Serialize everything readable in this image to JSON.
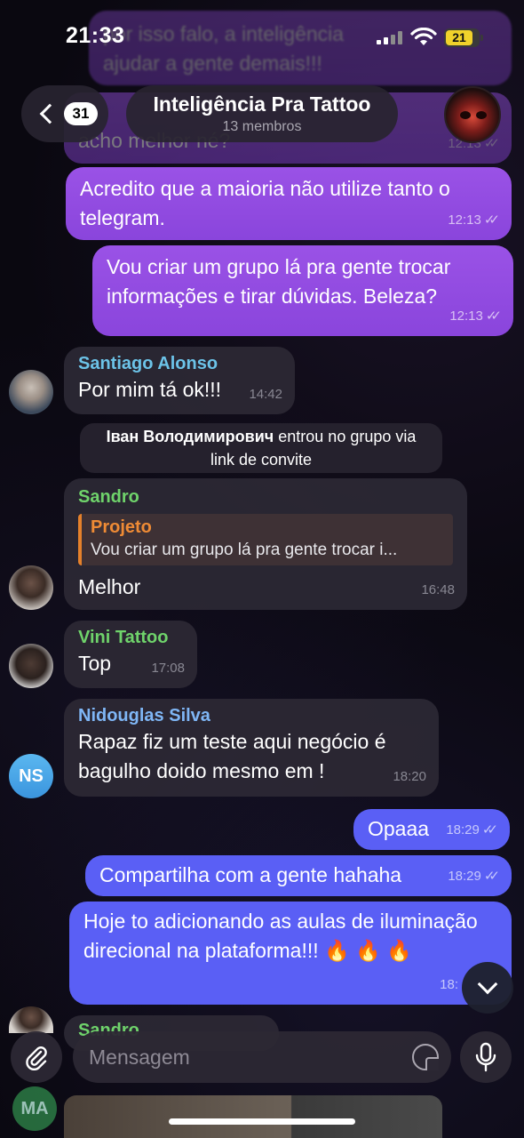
{
  "status_bar": {
    "time": "21:33",
    "battery": "21"
  },
  "header": {
    "back_count": "31",
    "title": "Inteligência Pra Tattoo",
    "subtitle": "13 membros"
  },
  "faded_top": {
    "line1": "por isso falo, a inteligência",
    "line2": "ajudar a gente demais!!!",
    "line3": "acho melhor né?"
  },
  "messages": [
    {
      "id": "m1",
      "text": "Acredito que a maioria não utilize tanto o telegram.",
      "time": "12:13"
    },
    {
      "id": "m2",
      "text": "Vou criar um grupo lá pra gente trocar informações e tirar dúvidas. Beleza?",
      "time": "12:13"
    },
    {
      "id": "m3",
      "sender": "Santiago Alonso",
      "text": "Por mim tá ok!!!",
      "time": "14:42"
    },
    {
      "id": "m4",
      "sender": "Sandro",
      "reply_title": "Projeto",
      "reply_text": "Vou criar um grupo lá pra gente trocar i...",
      "text": "Melhor",
      "time": "16:48"
    },
    {
      "id": "m5",
      "sender": "Vini Tattoo",
      "text": "Top",
      "time": "17:08"
    },
    {
      "id": "m6",
      "sender": "Nidouglas Silva",
      "text": "Rapaz fiz um teste aqui negócio é bagulho doido mesmo em !",
      "time": "18:20"
    },
    {
      "id": "m7",
      "text": "Opaaa",
      "time": "18:29"
    },
    {
      "id": "m8",
      "text": "Compartilha com a gente hahaha",
      "time": "18:29"
    },
    {
      "id": "m9",
      "text": "Hoje to adicionando as aulas de iluminação direcional na plataforma!!! 🔥 🔥 🔥",
      "time": "18:"
    }
  ],
  "service": {
    "name": "Іван Володимирович",
    "text": " entrou no grupo via link de convite"
  },
  "avatars": {
    "ns": "NS",
    "ma": "MA"
  },
  "partial_sender": "Sandro",
  "input": {
    "placeholder": "Mensagem"
  },
  "colors": {
    "outgoing_purple": "#8a45dc",
    "outgoing_blue": "#5a5ff5",
    "incoming": "#2c2834",
    "sender_santiago": "#6cc3e8",
    "sender_green": "#6fd36b",
    "sender_nidouglas": "#7fb6f5",
    "reply_accent": "#e5812b"
  },
  "icons": [
    "back-chevron-icon",
    "wifi-icon",
    "battery-icon",
    "attach-icon",
    "sticker-icon",
    "mic-icon",
    "chevron-down-icon",
    "double-check-icon"
  ]
}
